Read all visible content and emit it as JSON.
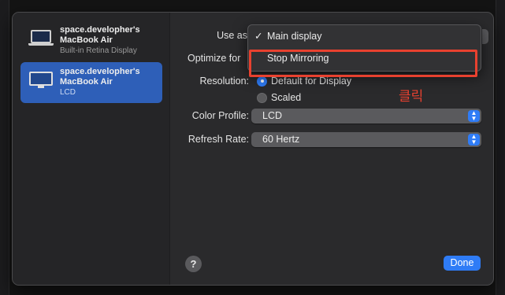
{
  "sidebar": {
    "items": [
      {
        "name_line1": "space.developher's",
        "name_line2": "MacBook Air",
        "subtitle": "Built-in Retina Display",
        "icon": "laptop-icon",
        "selected": false
      },
      {
        "name_line1": "space.developher's",
        "name_line2": "MacBook Air",
        "subtitle": "LCD",
        "icon": "monitor-icon",
        "selected": true
      }
    ]
  },
  "settings": {
    "use_as_label": "Use as",
    "optimize_label": "Optimize for",
    "resolution_label": "Resolution:",
    "resolution_options": [
      "Default for Display",
      "Scaled"
    ],
    "resolution_selected": "Default for Display",
    "color_profile_label": "Color Profile:",
    "color_profile_value": "LCD",
    "refresh_rate_label": "Refresh Rate:",
    "refresh_rate_value": "60 Hertz"
  },
  "use_as_menu": {
    "checkmark": "✓",
    "items": [
      "Main display",
      "Stop Mirroring"
    ],
    "checked_item": "Main display"
  },
  "annotation": {
    "text": "클릭",
    "color": "#e8412f"
  },
  "footer": {
    "help_label": "?",
    "done_label": "Done"
  },
  "colors": {
    "accent": "#2f7cf6",
    "selection": "#2e5fb8",
    "highlight": "#e8412f"
  }
}
